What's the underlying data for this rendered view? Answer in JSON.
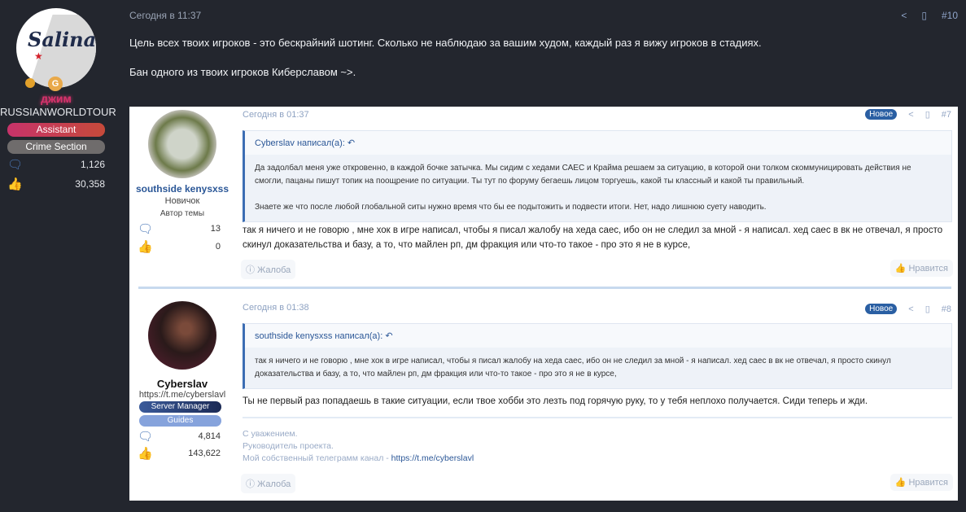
{
  "top_post": {
    "user": {
      "name": "джим",
      "title": "RUSSIANWORLDTOUR",
      "avatar_text": "Salinas",
      "banners": [
        "Assistant",
        "Crime Section"
      ],
      "messages": "1,126",
      "reactions": "30,358"
    },
    "date": "Сегодня в 11:37",
    "number": "#10",
    "body": [
      "Цель всех твоих игроков - это бескрайний шотинг. Сколько не наблюдаю за вашим худом, каждый раз я вижу игроков в стадиях.",
      "Бан одного из твоих игроков Киберславом ~>."
    ]
  },
  "posts": [
    {
      "user": {
        "name": "southside kenysxss",
        "title": "Новичок",
        "extra": "Автор темы",
        "messages": "13",
        "reactions": "0"
      },
      "date": "Сегодня в 01:37",
      "badge": "Новое",
      "number": "#7",
      "quote": {
        "author": "Cyberslav написал(а):",
        "lines": [
          "Да задолбал меня уже откровенно, в каждой бочке затычка. Мы сидим с хедами САЕС и Крайма решаем за ситуацию, в которой они толком скоммуницировать действия не смогли, пацаны пишут топик на поощрение по ситуации. Ты тут по форуму бегаешь лицом торгуешь, какой ты классный и какой ты правильный.",
          "Знаете же что после любой глобальной ситы нужно время что бы ее подытожить и подвести итоги. Нет, надо лишнюю суету наводить."
        ]
      },
      "body": "так я ничего и не говорю , мне хок в игре написал, чтобы я писал жалобу на хеда саес, ибо он не следил за мной - я написал. хед саес в вк не отвечал, я просто скинул доказательства и базу, а то, что майлен рп, дм фракция или что-то такое - про это я не в курсе,",
      "report": "Жалоба",
      "like": "Нравится"
    },
    {
      "user": {
        "name": "Cyberslav",
        "title": "https://t.me/cyberslavl",
        "banners": [
          "Server Manager",
          "Guides"
        ],
        "messages": "4,814",
        "reactions": "143,622"
      },
      "date": "Сегодня в 01:38",
      "badge": "Новое",
      "number": "#8",
      "quote": {
        "author": "southside kenysxss написал(а):",
        "lines": [
          "так я ничего и не говорю , мне хок в игре написал, чтобы я писал жалобу на хеда саес, ибо он не следил за мной - я написал. хед саес в вк не отвечал, я просто скинул доказательства и базу, а то, что майлен рп, дм фракция или что-то такое - про это я не в курсе,"
        ]
      },
      "body": "Ты не первый раз попадаешь в такие ситуации, если твое хобби это лезть под горячую руку, то у тебя неплохо получается. Сиди теперь и жди.",
      "signature": [
        "С уважением.",
        "Руководитель проекта.",
        "Мой собственный телеграмм канал - "
      ],
      "signature_link": "https://t.me/cyberslavl",
      "report": "Жалоба",
      "like": "Нравится"
    }
  ]
}
